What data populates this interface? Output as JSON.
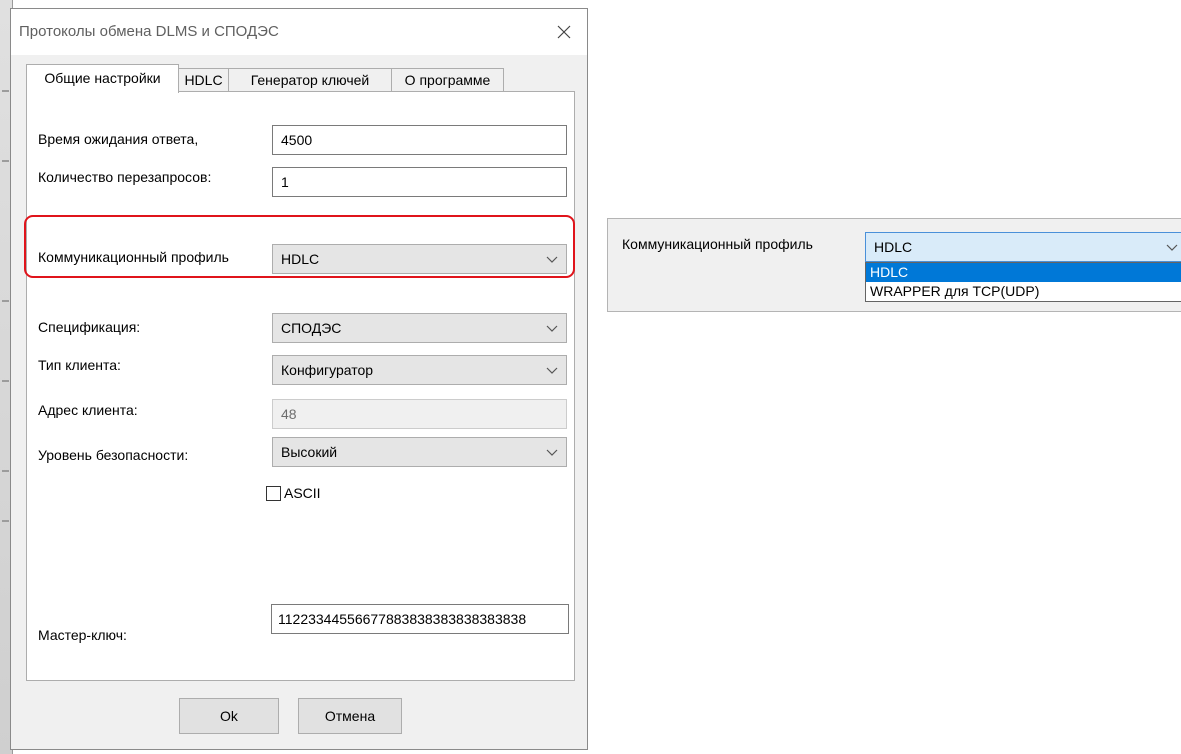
{
  "dialog": {
    "title": "Протоколы обмена DLMS и СПОДЭС",
    "close_glyph": "✕"
  },
  "tabs": [
    {
      "label": "Общие настройки",
      "active": true
    },
    {
      "label": "HDLC",
      "active": false
    },
    {
      "label": "Генератор ключей",
      "active": false
    },
    {
      "label": "О программе",
      "active": false
    }
  ],
  "form": {
    "response_timeout": {
      "label": "Время ожидания ответа,",
      "value": "4500"
    },
    "retry_count": {
      "label": "Количество перезапросов:",
      "value": "1"
    },
    "comm_profile": {
      "label": "Коммуникационный профиль",
      "value": "HDLC"
    },
    "specification": {
      "label": "Спецификация:",
      "value": "СПОДЭС"
    },
    "client_type": {
      "label": "Тип клиента:",
      "value": "Конфигуратор"
    },
    "client_address": {
      "label": "Адрес клиента:",
      "value": "48"
    },
    "security_level": {
      "label": "Уровень безопасности:",
      "value": "Высокий"
    },
    "ascii": {
      "label": "ASCII",
      "checked": false
    },
    "master_key": {
      "label": "Мастер-ключ:",
      "value": "11223344556677883838383838383838"
    }
  },
  "buttons": {
    "ok": "Ok",
    "cancel": "Отмена"
  },
  "zoom_panel": {
    "label": "Коммуникационный профиль",
    "selected": "HDLC",
    "options": [
      "HDLC",
      "WRAPPER для TCP(UDP)"
    ]
  },
  "colors": {
    "highlight": "#e0141b",
    "selection": "#0078d7"
  },
  "icons": {
    "close": "close-icon",
    "dropdown": "chevron-down-icon",
    "checkbox": "checkbox-icon"
  }
}
